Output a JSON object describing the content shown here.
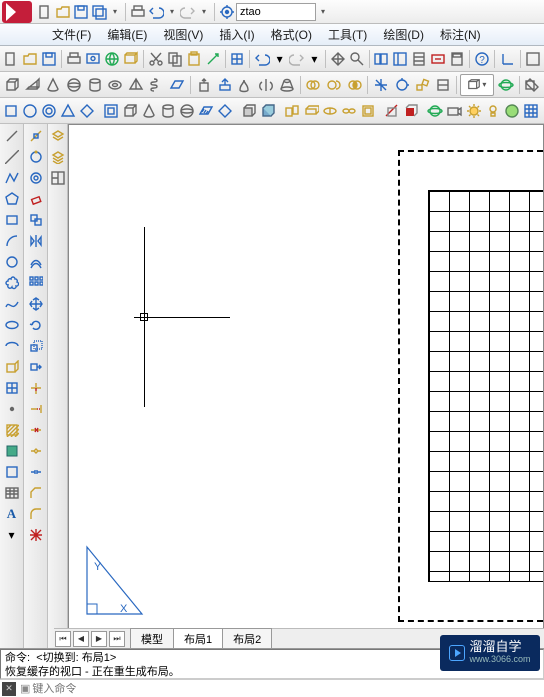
{
  "qat": {
    "workspace": "ztao"
  },
  "menu": {
    "file": "文件(F)",
    "edit": "编辑(E)",
    "view": "视图(V)",
    "insert": "插入(I)",
    "format": "格式(O)",
    "tools": "工具(T)",
    "draw": "绘图(D)",
    "annotate": "标注(N)"
  },
  "tabs": {
    "model": "模型",
    "layout1": "布局1",
    "layout2": "布局2",
    "active": "布局1"
  },
  "cmd": {
    "prefix": "命令:",
    "line1": "<切换到: 布局1>",
    "line2": "恢复缓存的视口 - 正在重生成布局。",
    "placeholder": "键入命令"
  },
  "watermark": {
    "brand": "溜溜自学",
    "url": "www.3066.com"
  }
}
